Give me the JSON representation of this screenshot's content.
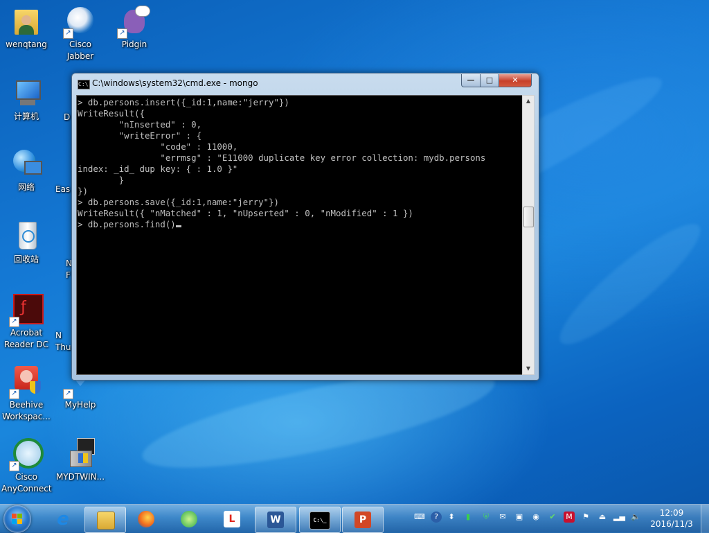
{
  "desktop": {
    "icons": [
      {
        "name": "wenqtang",
        "label": "wenqtang",
        "icon": "user-folder-icon"
      },
      {
        "name": "cisco-jabber",
        "label": "Cisco\nJabber",
        "icon": "cisco-jabber-icon"
      },
      {
        "name": "pidgin",
        "label": "Pidgin",
        "icon": "pidgin-icon"
      },
      {
        "name": "computer",
        "label": "计算机",
        "icon": "computer-icon"
      },
      {
        "name": "network",
        "label": "网络",
        "icon": "network-icon"
      },
      {
        "name": "recycle-bin",
        "label": "回收站",
        "icon": "recycle-bin-icon"
      },
      {
        "name": "acrobat-reader",
        "label": "Acrobat\nReader DC",
        "icon": "acrobat-icon"
      },
      {
        "name": "beehive",
        "label": "Beehive\nWorkspac...",
        "icon": "beehive-icon"
      },
      {
        "name": "myhelp",
        "label": "MyHelp",
        "icon": "myhelp-icon"
      },
      {
        "name": "cisco-anyconnect",
        "label": "Cisco\nAnyConnect",
        "icon": "anyconnect-icon"
      },
      {
        "name": "mydtwin",
        "label": "MYDTWIN...",
        "icon": "mydtwin-icon"
      }
    ],
    "partial_labels": [
      "D",
      "Eas",
      "N\nF",
      "N\nThu"
    ]
  },
  "cmd_window": {
    "title": "C:\\windows\\system32\\cmd.exe - mongo",
    "buttons": {
      "minimize": "—",
      "maximize": "□",
      "close": "✕"
    },
    "console_lines": [
      "> db.persons.insert({_id:1,name:\"jerry\"})",
      "WriteResult({",
      "        \"nInserted\" : 0,",
      "        \"writeError\" : {",
      "                \"code\" : 11000,",
      "                \"errmsg\" : \"E11000 duplicate key error collection: mydb.persons",
      "index: _id_ dup key: { : 1.0 }\"",
      "        }",
      "})",
      "> db.persons.save({_id:1,name:\"jerry\"})",
      "WriteResult({ \"nMatched\" : 1, \"nUpserted\" : 0, \"nModified\" : 1 })",
      "> db.persons.find()"
    ]
  },
  "taskbar": {
    "pinned": [
      {
        "name": "internet-explorer",
        "icon": "internet-explorer-icon",
        "glyph": "e"
      },
      {
        "name": "file-explorer",
        "icon": "folder-icon",
        "glyph": ""
      },
      {
        "name": "firefox",
        "icon": "firefox-icon",
        "glyph": ""
      },
      {
        "name": "green-app",
        "icon": "refresh-globe-icon",
        "glyph": ""
      },
      {
        "name": "letv",
        "icon": "letv-icon",
        "glyph": "L"
      },
      {
        "name": "word",
        "icon": "word-icon",
        "glyph": "W"
      },
      {
        "name": "cmd",
        "icon": "cmd-icon",
        "glyph": "C:\\_"
      },
      {
        "name": "powerpoint",
        "icon": "powerpoint-icon",
        "glyph": "P"
      }
    ],
    "tray_icons": [
      "keyboard-icon",
      "help-icon",
      "arrow-icon",
      "battery-plus-icon",
      "shield-icon",
      "mail-icon",
      "monitor-icon",
      "network-globe-icon",
      "security-icon",
      "mcafee-icon",
      "flag-icon",
      "usb-icon",
      "signal-icon",
      "volume-icon"
    ],
    "clock": {
      "time": "12:09",
      "date": "2016/11/3"
    }
  }
}
